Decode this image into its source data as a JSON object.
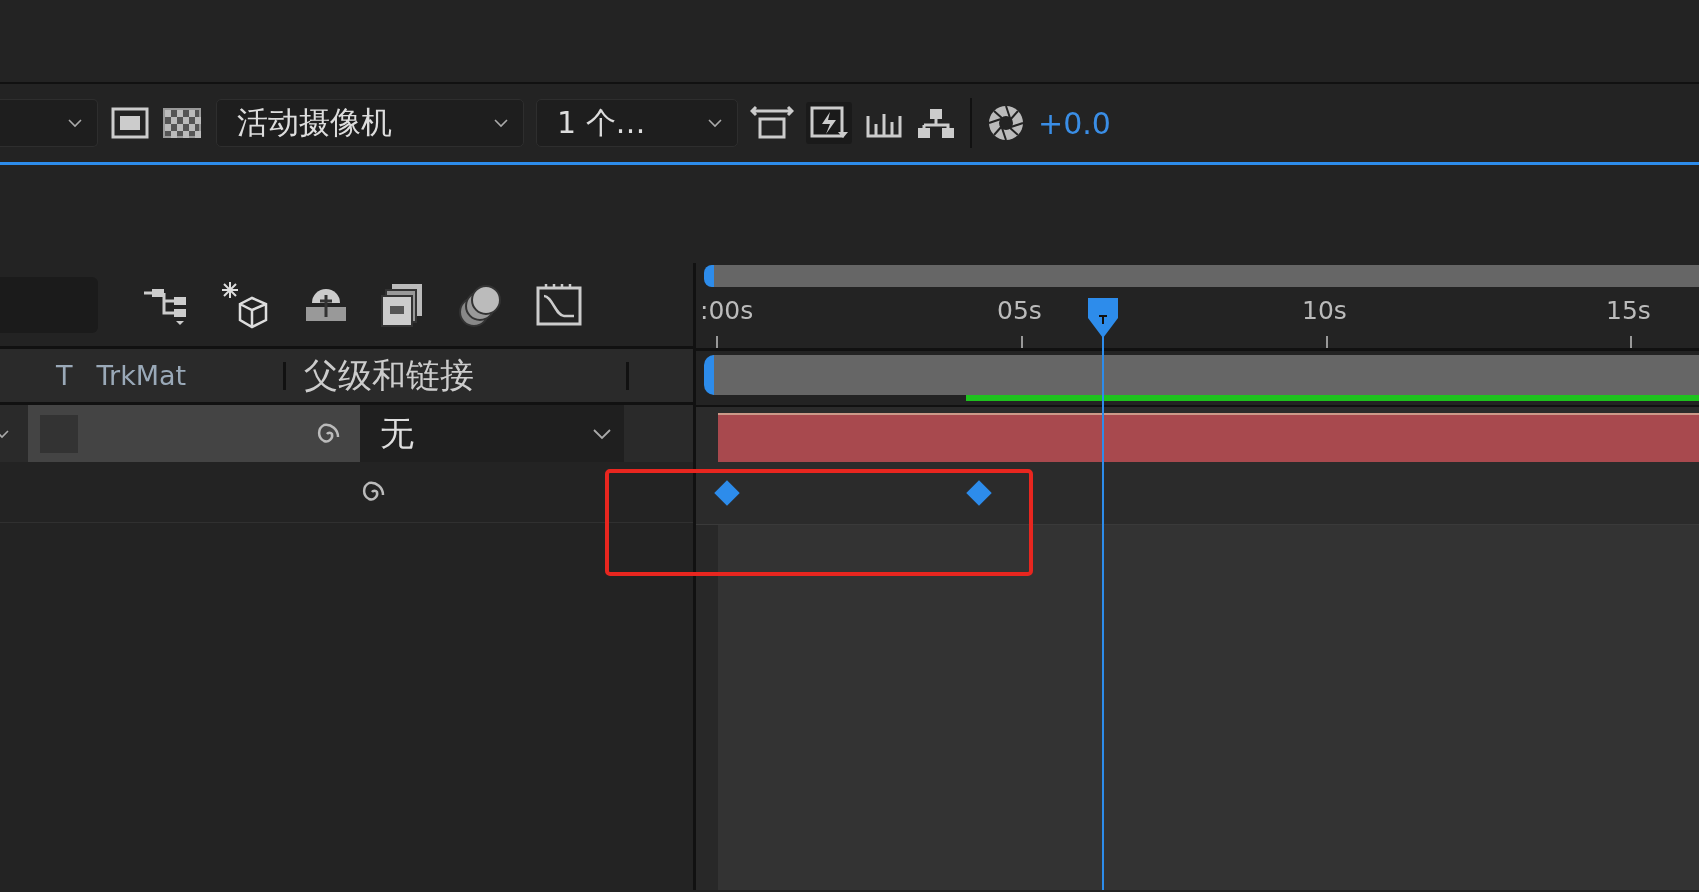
{
  "toolbar": {
    "camera_dropdown": {
      "value": "活动摄像机"
    },
    "views_dropdown": {
      "value": "1 个…"
    },
    "exposure": "+0.0"
  },
  "timeline_ruler": {
    "labels": [
      ":00s",
      "05s",
      "10s",
      "15s"
    ]
  },
  "columns": [
    {
      "label": "T"
    },
    {
      "label": "TrkMat"
    },
    {
      "label": "父级和链接"
    }
  ],
  "layer": {
    "parent": "无"
  },
  "keyframes": [
    {
      "selected": true
    },
    {
      "selected": true
    }
  ]
}
